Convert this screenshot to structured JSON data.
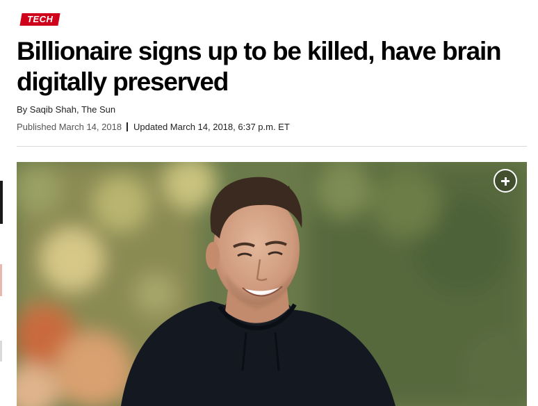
{
  "article": {
    "section_tag": "TECH",
    "headline": "Billionaire signs up to be killed, have brain digitally preserved",
    "byline": "By Saqib Shah, The Sun",
    "published": "Published March 14, 2018",
    "updated": "Updated March 14, 2018, 6:37 p.m. ET"
  },
  "media": {
    "expand_icon": "plus-circle-icon",
    "accent_color": "#d0021b"
  }
}
